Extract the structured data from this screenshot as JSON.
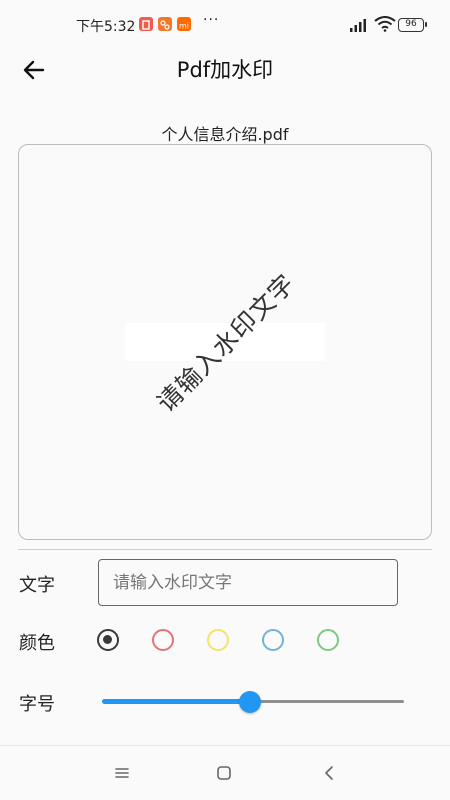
{
  "status_bar": {
    "time": "下午5:32",
    "battery": "96",
    "app_icons": [
      {
        "name": "red-app-icon",
        "color": "#ef5b4c"
      },
      {
        "name": "orange-app-icon",
        "color": "#f0772c"
      },
      {
        "name": "mi-app-icon",
        "color": "#ff6900"
      }
    ],
    "more": "···"
  },
  "header": {
    "title": "Pdf加水印",
    "back_icon": "back-arrow-icon"
  },
  "file": {
    "name": "个人信息介绍.pdf"
  },
  "preview": {
    "watermark_text": "请输入水印文字"
  },
  "form": {
    "text_label": "文字",
    "text_placeholder": "请输入水印文字",
    "text_value": "",
    "color_label": "颜色",
    "colors": [
      {
        "name": "dark",
        "hex": "#3a3a3a",
        "selected": true
      },
      {
        "name": "red",
        "hex": "#e57373",
        "selected": false
      },
      {
        "name": "yellow",
        "hex": "#f3e36a",
        "selected": false
      },
      {
        "name": "blue",
        "hex": "#6fb4d8",
        "selected": false
      },
      {
        "name": "green",
        "hex": "#81c784",
        "selected": false
      }
    ],
    "size_label": "字号",
    "size_value_fraction": 0.49
  },
  "nav_bar": {
    "menu_icon": "menu-icon",
    "home_icon": "home-square-icon",
    "back_icon": "back-chevron-icon"
  },
  "theme": {
    "accent": "#2196f3"
  }
}
